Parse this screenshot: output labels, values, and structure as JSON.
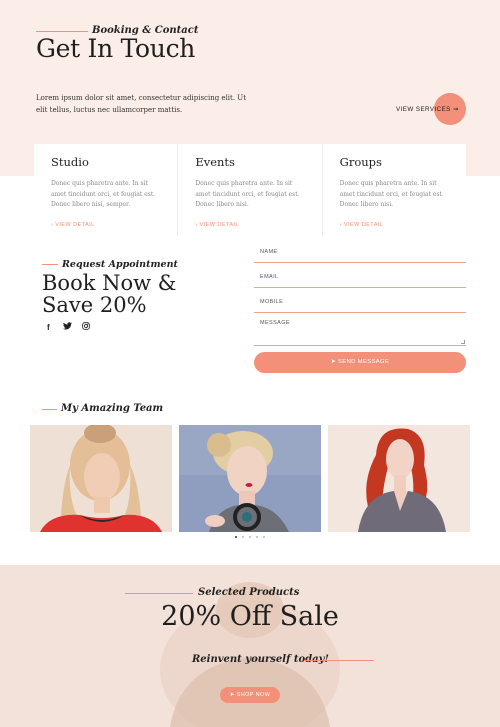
{
  "hero": {
    "script": "Booking & Contact",
    "title": "Get In Touch",
    "description": "Lorem ipsum dolor sit amet, consectetur adipiscing elit. Ut elit tellus, luctus nec ullamcorper mattis.",
    "view_services": "VIEW SERVICES",
    "arrow_icon": "arrow-right-icon"
  },
  "cards": [
    {
      "title": "Studio",
      "text": "Donec quis pharetra ante. In sit amet tincidunt orci, et feugiat est. Donec libero nisi, semper.",
      "link": "› VIEW DETAIL"
    },
    {
      "title": "Events",
      "text": "Donec quis pharetra ante. In sit amet tincidunt orci, et feugiat est. Donec libero nisi.",
      "link": "› VIEW DETAIL"
    },
    {
      "title": "Groups",
      "text": "Donec quis pharetra ante. In sit amet tincidunt orci, et feugiat est. Donec libero nisi.",
      "link": "› VIEW DETAIL"
    }
  ],
  "booking": {
    "script": "Request Appointment",
    "title_line1": "Book Now &",
    "title_line2": "Save 20%",
    "social": {
      "facebook": "f",
      "twitter": "🐦",
      "instagram": "◎"
    }
  },
  "form": {
    "name_label": "NAME",
    "email_label": "EMAIL",
    "mobile_label": "MOBILE",
    "message_label": "MESSAGE",
    "send_label": "➤ SEND MESSAGE"
  },
  "team": {
    "script": "My Amazing Team",
    "members": [
      {
        "photo": "team-member-1-photo"
      },
      {
        "photo": "team-member-2-photo"
      },
      {
        "photo": "team-member-3-photo"
      }
    ],
    "slides": 5,
    "active_slide": 1
  },
  "sale": {
    "script": "Selected Products",
    "title": "20% Off Sale",
    "tagline": "Reinvent yourself today!",
    "shop_label": "➤ SHOP NOW"
  },
  "colors": {
    "accent": "#f3907a",
    "top_band": "#fbeee8",
    "sale_band": "#f3e2d9"
  }
}
